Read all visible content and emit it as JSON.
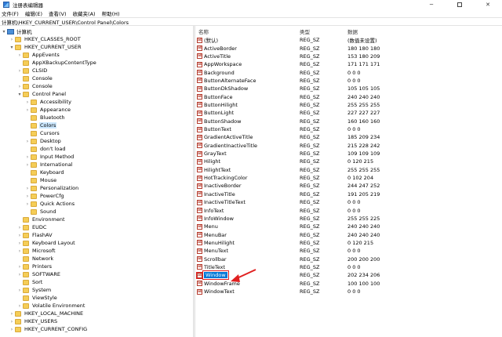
{
  "window": {
    "title": "注册表编辑器",
    "controls": {
      "minimize": "─",
      "maximize": "",
      "close": "✕"
    }
  },
  "menu": [
    "文件(F)",
    "编辑(E)",
    "查看(V)",
    "收藏夹(A)",
    "帮助(H)"
  ],
  "address": "计算机\\HKEY_CURRENT_USER\\Control Panel\\Colors",
  "tree": [
    {
      "label": "计算机",
      "depth": 0,
      "arrow": "▾",
      "icon": "computer"
    },
    {
      "label": "HKEY_CLASSES_ROOT",
      "depth": 1,
      "arrow": "›",
      "icon": "folder"
    },
    {
      "label": "HKEY_CURRENT_USER",
      "depth": 1,
      "arrow": "▾",
      "icon": "folder"
    },
    {
      "label": "AppEvents",
      "depth": 2,
      "arrow": "›",
      "icon": "folder"
    },
    {
      "label": "AppXBackupContentType",
      "depth": 2,
      "arrow": "",
      "icon": "folder"
    },
    {
      "label": "CLSID",
      "depth": 2,
      "arrow": "›",
      "icon": "folder"
    },
    {
      "label": "Console",
      "depth": 2,
      "arrow": "",
      "icon": "folder"
    },
    {
      "label": "Console",
      "depth": 2,
      "arrow": "›",
      "icon": "folder"
    },
    {
      "label": "Control Panel",
      "depth": 2,
      "arrow": "▾",
      "icon": "folder"
    },
    {
      "label": "Accessibility",
      "depth": 3,
      "arrow": "›",
      "icon": "folder"
    },
    {
      "label": "Appearance",
      "depth": 3,
      "arrow": "›",
      "icon": "folder"
    },
    {
      "label": "Bluetooth",
      "depth": 3,
      "arrow": "",
      "icon": "folder"
    },
    {
      "label": "Colors",
      "depth": 3,
      "arrow": "",
      "icon": "folder",
      "selected": true
    },
    {
      "label": "Cursors",
      "depth": 3,
      "arrow": "",
      "icon": "folder"
    },
    {
      "label": "Desktop",
      "depth": 3,
      "arrow": "›",
      "icon": "folder"
    },
    {
      "label": "don't load",
      "depth": 3,
      "arrow": "",
      "icon": "folder"
    },
    {
      "label": "Input Method",
      "depth": 3,
      "arrow": "›",
      "icon": "folder"
    },
    {
      "label": "International",
      "depth": 3,
      "arrow": "›",
      "icon": "folder"
    },
    {
      "label": "Keyboard",
      "depth": 3,
      "arrow": "",
      "icon": "folder"
    },
    {
      "label": "Mouse",
      "depth": 3,
      "arrow": "",
      "icon": "folder"
    },
    {
      "label": "Personalization",
      "depth": 3,
      "arrow": "›",
      "icon": "folder"
    },
    {
      "label": "PowerCfg",
      "depth": 3,
      "arrow": "›",
      "icon": "folder"
    },
    {
      "label": "Quick Actions",
      "depth": 3,
      "arrow": "›",
      "icon": "folder"
    },
    {
      "label": "Sound",
      "depth": 3,
      "arrow": "",
      "icon": "folder"
    },
    {
      "label": "Environment",
      "depth": 2,
      "arrow": "",
      "icon": "folder"
    },
    {
      "label": "EUDC",
      "depth": 2,
      "arrow": "›",
      "icon": "folder"
    },
    {
      "label": "FlashAV",
      "depth": 2,
      "arrow": "›",
      "icon": "folder"
    },
    {
      "label": "Keyboard Layout",
      "depth": 2,
      "arrow": "›",
      "icon": "folder"
    },
    {
      "label": "Microsoft",
      "depth": 2,
      "arrow": "›",
      "icon": "folder"
    },
    {
      "label": "Network",
      "depth": 2,
      "arrow": "",
      "icon": "folder"
    },
    {
      "label": "Printers",
      "depth": 2,
      "arrow": "›",
      "icon": "folder"
    },
    {
      "label": "SOFTWARE",
      "depth": 2,
      "arrow": "›",
      "icon": "folder"
    },
    {
      "label": "Sort",
      "depth": 2,
      "arrow": "",
      "icon": "folder"
    },
    {
      "label": "System",
      "depth": 2,
      "arrow": "›",
      "icon": "folder"
    },
    {
      "label": "ViewStyle",
      "depth": 2,
      "arrow": "",
      "icon": "folder"
    },
    {
      "label": "Volatile Environment",
      "depth": 2,
      "arrow": "›",
      "icon": "folder"
    },
    {
      "label": "HKEY_LOCAL_MACHINE",
      "depth": 1,
      "arrow": "›",
      "icon": "folder"
    },
    {
      "label": "HKEY_USERS",
      "depth": 1,
      "arrow": "›",
      "icon": "folder"
    },
    {
      "label": "HKEY_CURRENT_CONFIG",
      "depth": 1,
      "arrow": "›",
      "icon": "folder"
    }
  ],
  "list": {
    "headers": {
      "name": "名称",
      "type": "类型",
      "data": "数据"
    },
    "value_icon": "ab",
    "rows": [
      {
        "name": "(默认)",
        "type": "REG_SZ",
        "data": "(数值未设置)"
      },
      {
        "name": "ActiveBorder",
        "type": "REG_SZ",
        "data": "180 180 180"
      },
      {
        "name": "ActiveTitle",
        "type": "REG_SZ",
        "data": "153 180 209"
      },
      {
        "name": "AppWorkspace",
        "type": "REG_SZ",
        "data": "171 171 171"
      },
      {
        "name": "Background",
        "type": "REG_SZ",
        "data": "0 0 0"
      },
      {
        "name": "ButtonAlternateFace",
        "type": "REG_SZ",
        "data": "0 0 0"
      },
      {
        "name": "ButtonDkShadow",
        "type": "REG_SZ",
        "data": "105 105 105"
      },
      {
        "name": "ButtonFace",
        "type": "REG_SZ",
        "data": "240 240 240"
      },
      {
        "name": "ButtonHilight",
        "type": "REG_SZ",
        "data": "255 255 255"
      },
      {
        "name": "ButtonLight",
        "type": "REG_SZ",
        "data": "227 227 227"
      },
      {
        "name": "ButtonShadow",
        "type": "REG_SZ",
        "data": "160 160 160"
      },
      {
        "name": "ButtonText",
        "type": "REG_SZ",
        "data": "0 0 0"
      },
      {
        "name": "GradientActiveTitle",
        "type": "REG_SZ",
        "data": "185 209 234"
      },
      {
        "name": "GradientInactiveTitle",
        "type": "REG_SZ",
        "data": "215 228 242"
      },
      {
        "name": "GrayText",
        "type": "REG_SZ",
        "data": "109 109 109"
      },
      {
        "name": "Hilight",
        "type": "REG_SZ",
        "data": "0 120 215"
      },
      {
        "name": "HilightText",
        "type": "REG_SZ",
        "data": "255 255 255"
      },
      {
        "name": "HotTrackingColor",
        "type": "REG_SZ",
        "data": "0 102 204"
      },
      {
        "name": "InactiveBorder",
        "type": "REG_SZ",
        "data": "244 247 252"
      },
      {
        "name": "InactiveTitle",
        "type": "REG_SZ",
        "data": "191 205 219"
      },
      {
        "name": "InactiveTitleText",
        "type": "REG_SZ",
        "data": "0 0 0"
      },
      {
        "name": "InfoText",
        "type": "REG_SZ",
        "data": "0 0 0"
      },
      {
        "name": "InfoWindow",
        "type": "REG_SZ",
        "data": "255 255 225"
      },
      {
        "name": "Menu",
        "type": "REG_SZ",
        "data": "240 240 240"
      },
      {
        "name": "MenuBar",
        "type": "REG_SZ",
        "data": "240 240 240"
      },
      {
        "name": "MenuHilight",
        "type": "REG_SZ",
        "data": "0 120 215"
      },
      {
        "name": "MenuText",
        "type": "REG_SZ",
        "data": "0 0 0"
      },
      {
        "name": "Scrollbar",
        "type": "REG_SZ",
        "data": "200 200 200"
      },
      {
        "name": "TitleText",
        "type": "REG_SZ",
        "data": "0 0 0"
      },
      {
        "name": "Window",
        "type": "REG_SZ",
        "data": "202 234 206",
        "selected": true
      },
      {
        "name": "WindowFrame",
        "type": "REG_SZ",
        "data": "100 100 100"
      },
      {
        "name": "WindowText",
        "type": "REG_SZ",
        "data": "0 0 0"
      }
    ]
  },
  "colors": {
    "selection": "#0078d7",
    "annotation": "#e02020"
  }
}
